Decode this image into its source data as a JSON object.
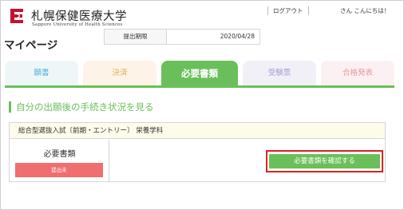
{
  "header": {
    "logo_title": "札幌保健医療大学",
    "logo_sub": "Sapporo University of Health Sciences",
    "logout": "ログアウト",
    "greeting": "さん こんにちは！"
  },
  "page_title": "マイページ",
  "tabs": [
    {
      "label": "願書"
    },
    {
      "label": "決済"
    },
    {
      "label": "必要書類",
      "active": true
    },
    {
      "label": "受験票"
    },
    {
      "label": "合格発表"
    }
  ],
  "section_title": "自分の出願後の手続き状況を見る",
  "application": {
    "heading": "総合型選抜入試〔前期・エントリー〕 栄養学科",
    "doc_label": "必要書類",
    "status": "提出未",
    "deadline_label": "提出期限",
    "deadline_value": "2020/04/28",
    "confirm_button": "必要書類を確認する"
  },
  "colors": {
    "accent": "#6bbf5a",
    "logo": "#c8102e",
    "status": "#f16e6e",
    "highlight": "#e02020"
  }
}
